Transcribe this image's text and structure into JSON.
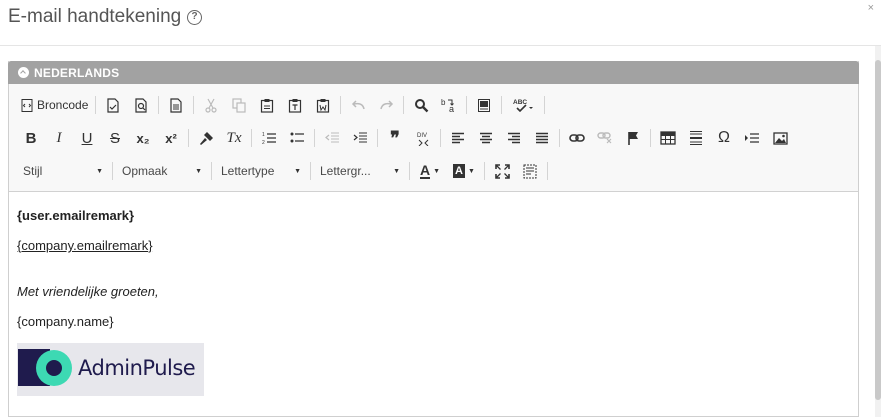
{
  "dialog": {
    "title": "E-mail handtekening",
    "help_icon": "question-circle-icon",
    "close_label": "×"
  },
  "panel": {
    "header_label": "NEDERLANDS",
    "collapse_icon": "chevron-up-circle-icon"
  },
  "toolbar": {
    "source_label": "Broncode",
    "style_combo": "Stijl",
    "format_combo": "Opmaak",
    "font_combo": "Lettertype",
    "size_combo": "Lettergr...",
    "glyphs": {
      "bold": "B",
      "italic": "I",
      "underline": "U",
      "strike": "S",
      "subscript": "x₂",
      "superscript": "x²",
      "clear_format": "Tx",
      "blockquote": "❞",
      "omega": "Ω",
      "text_color": "A",
      "bg_color": "A",
      "spellcheck": "ABC"
    }
  },
  "editor": {
    "line1": "{user.emailremark}",
    "line2": "{company.emailremark}",
    "line3": "Met vriendelijke groeten,",
    "line4": "{company.name}",
    "logo_text": "AdminPulse"
  },
  "colors": {
    "panel_header_bg": "#a2a2a2",
    "logo_accent": "#3dd9b3",
    "logo_dark": "#1f1b4d"
  }
}
